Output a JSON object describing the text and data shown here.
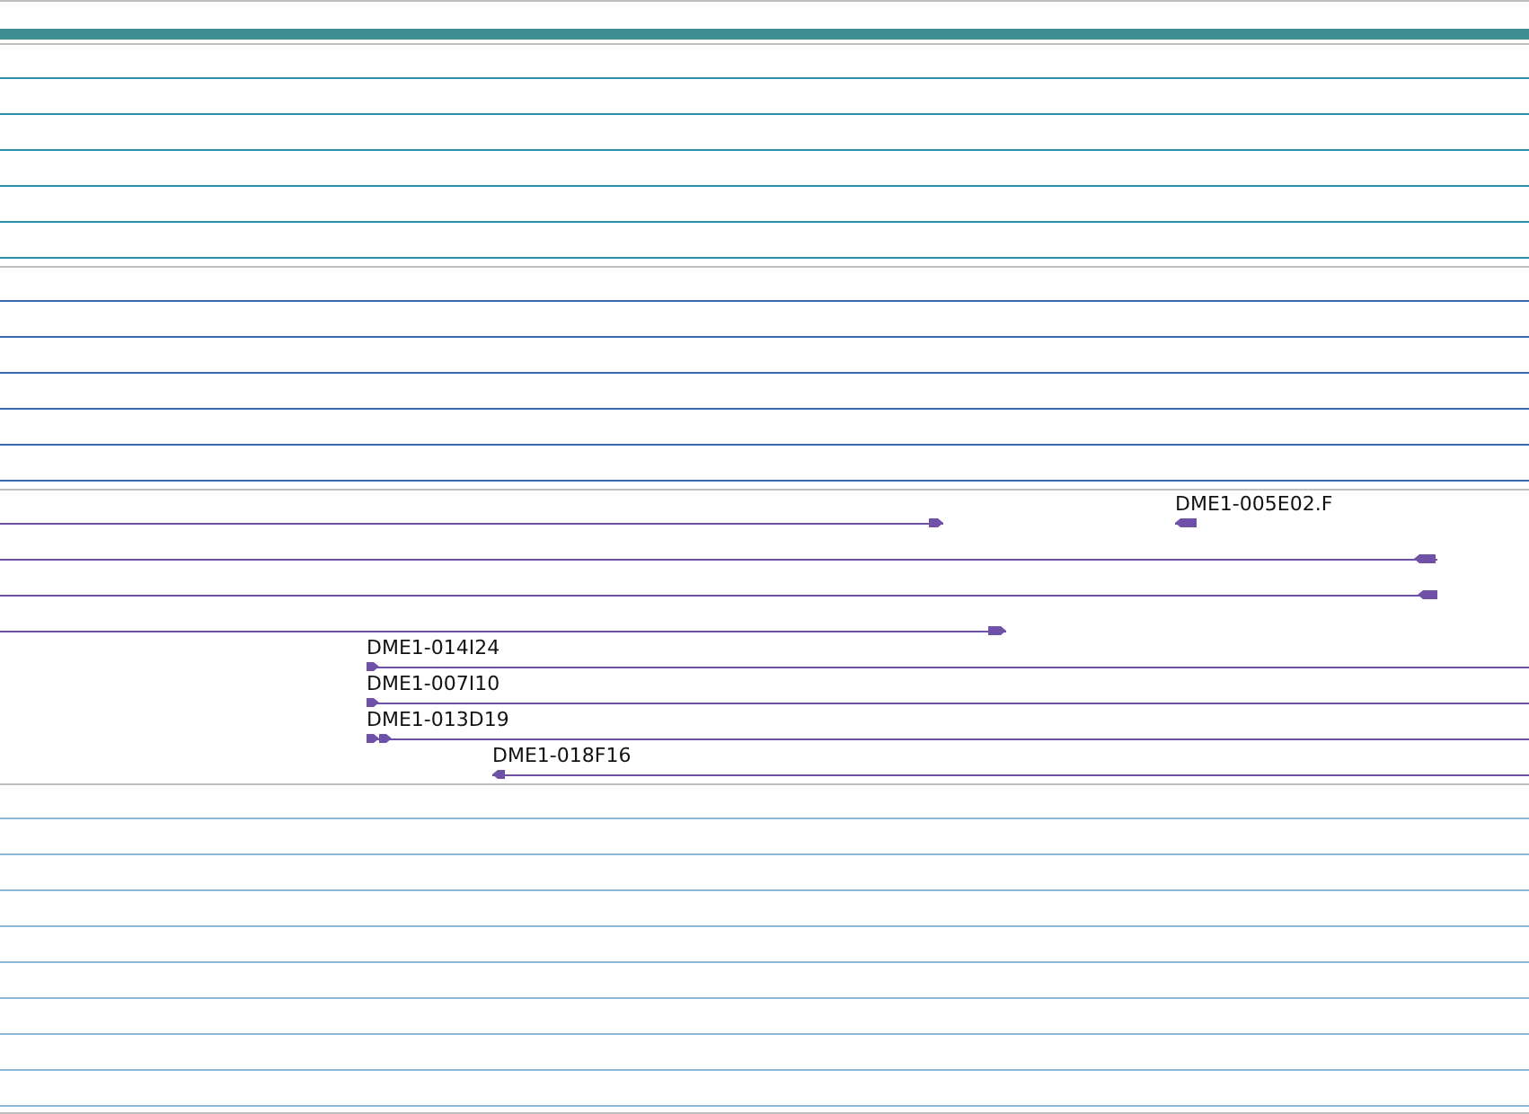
{
  "tracks": [
    {
      "kind": "bar",
      "color": "#3d8f91"
    },
    {
      "kind": "lines",
      "color": "#2a8fa8"
    },
    {
      "kind": "lines",
      "color": "#3a68b0"
    },
    {
      "kind": "features",
      "color": "#6f52a8",
      "rows": [
        {
          "features": [
            {
              "kind": "arrow",
              "reverse": false
            },
            {
              "kind": "arrow",
              "reverse": true,
              "label": "DME1-005E02.F"
            }
          ]
        },
        {
          "features": [
            {
              "kind": "arrow",
              "reverse": true
            }
          ]
        },
        {
          "features": [
            {
              "kind": "arrow",
              "reverse": true
            }
          ]
        },
        {
          "features": [
            {
              "kind": "arrow",
              "reverse": false
            }
          ]
        },
        {
          "features": [
            {
              "kind": "arrow",
              "reverse": false,
              "label": "DME1-014I24"
            }
          ]
        },
        {
          "features": [
            {
              "kind": "arrow",
              "reverse": false,
              "label": "DME1-007I10"
            }
          ]
        },
        {
          "features": [
            {
              "kind": "double-arrow",
              "reverse": false,
              "label": "DME1-013D19"
            }
          ]
        },
        {
          "features": [
            {
              "kind": "arrow",
              "reverse": true,
              "label": "DME1-018F16"
            }
          ]
        }
      ]
    },
    {
      "kind": "lines",
      "color": "#8ab8d8"
    }
  ]
}
